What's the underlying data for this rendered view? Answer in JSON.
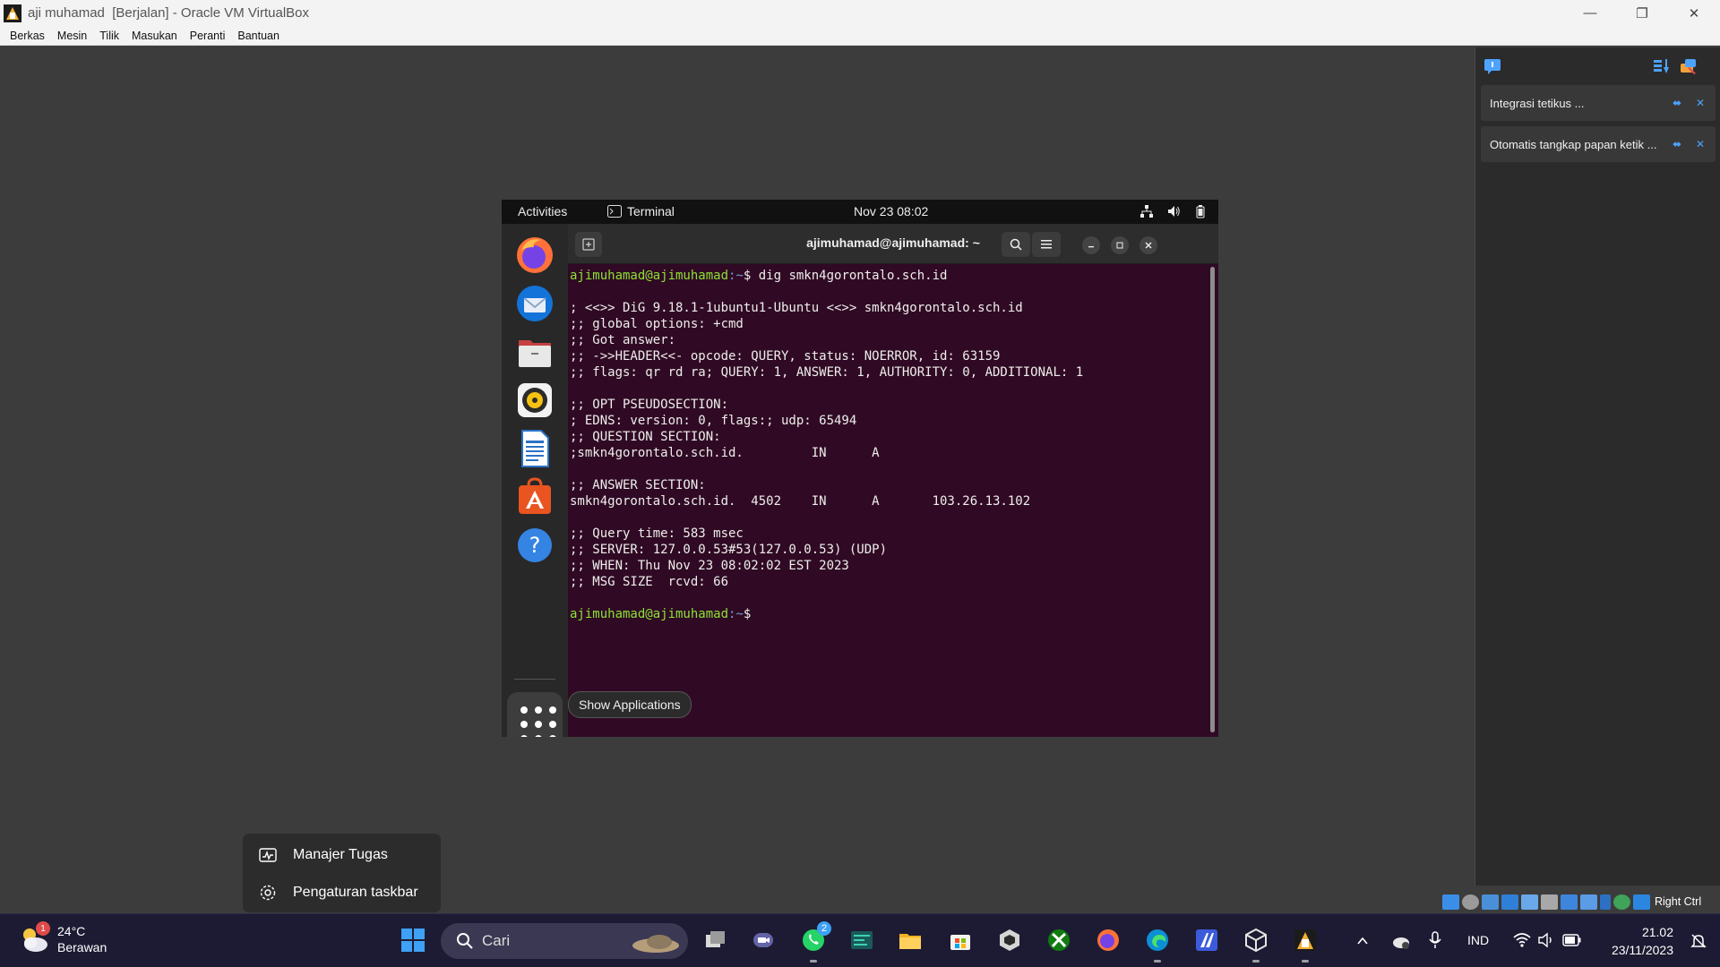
{
  "window": {
    "title": "aji muhamad  [Berjalan] - Oracle VM VirtualBox",
    "menu": [
      "Berkas",
      "Mesin",
      "Tilik",
      "Masukan",
      "Peranti",
      "Bantuan"
    ],
    "controls": {
      "minimize": "—",
      "maximize": "❐",
      "close": "✕"
    }
  },
  "notifications": {
    "items": [
      {
        "label": "Integrasi tetikus ..."
      },
      {
        "label": "Otomatis tangkap papan ketik ..."
      }
    ],
    "pin_glyph": "⬌",
    "close_glyph": "✕"
  },
  "statusbar": {
    "host_key": "Right Ctrl"
  },
  "vm": {
    "topbar": {
      "activities": "Activities",
      "app_name": "Terminal",
      "clock": "Nov 23  08:02"
    },
    "dock": {
      "apps": [
        "firefox-icon",
        "thunderbird-icon",
        "files-icon",
        "rhythmbox-icon",
        "writer-icon",
        "app-center-icon",
        "help-icon"
      ],
      "tooltip": "Show Applications"
    },
    "terminal": {
      "title": "ajimuhamad@ajimuhamad: ~",
      "prompt_user": "ajimuhamad@ajimuhamad",
      "prompt_path": ":~",
      "prompt_symbol": "$ ",
      "command": "dig smkn4gorontalo.sch.id",
      "output": [
        "",
        "; <<>> DiG 9.18.1-1ubuntu1-Ubuntu <<>> smkn4gorontalo.sch.id",
        ";; global options: +cmd",
        ";; Got answer:",
        ";; ->>HEADER<<- opcode: QUERY, status: NOERROR, id: 63159",
        ";; flags: qr rd ra; QUERY: 1, ANSWER: 1, AUTHORITY: 0, ADDITIONAL: 1",
        "",
        ";; OPT PSEUDOSECTION:",
        "; EDNS: version: 0, flags:; udp: 65494",
        ";; QUESTION SECTION:",
        ";smkn4gorontalo.sch.id.         IN      A",
        "",
        ";; ANSWER SECTION:",
        "smkn4gorontalo.sch.id.  4502    IN      A       103.26.13.102",
        "",
        ";; Query time: 583 msec",
        ";; SERVER: 127.0.0.53#53(127.0.0.53) (UDP)",
        ";; WHEN: Thu Nov 23 08:02:02 EST 2023",
        ";; MSG SIZE  rcvd: 66",
        ""
      ]
    }
  },
  "context_menu": {
    "items": [
      {
        "label": "Manajer Tugas"
      },
      {
        "label": "Pengaturan taskbar"
      }
    ]
  },
  "taskbar": {
    "weather": {
      "temp": "24°C",
      "condition": "Berawan",
      "badge": "1"
    },
    "search_label": "Cari",
    "whatsapp_badge": "2",
    "language": "IND",
    "time": "21.02",
    "date": "23/11/2023",
    "colors": {
      "background": "#1d1b33",
      "accent": "#0078d4"
    }
  }
}
